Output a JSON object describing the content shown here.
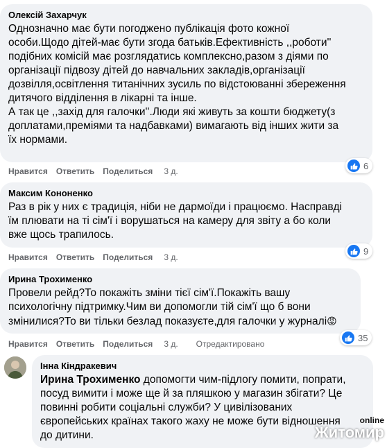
{
  "actions": {
    "like": "Нравится",
    "reply": "Ответить",
    "share": "Поделиться"
  },
  "comments": [
    {
      "author": "Олексій Захарчук",
      "text": "Однозначно має бути погоджено публікація фото кожної\nособи.Щодо дітей-має бути згода батьків.Ефективність ,,роботи''\nподібних комісій має розглядатись комплексно,разом з діями по\nорганізації підвозу дітей до навчальних закладів,організації\nдозвілля,освітлення титанічних зусиль по відстоюванні збереження\nдитячого відділення в лікарні та інше.\nА так це ,,захід для галочки''.Люди які живуть за кошти бюджету(з\nдоплатами,преміями та надбавками) вимагають від інших жити за\nїх нормами.",
      "time": "3 д.",
      "reactions": "6"
    },
    {
      "author": "Максим Кононенко",
      "text": "Раз в рік у них є традиція, ніби не дармоїди і працюємо. Насправді\nїм плювати на ті сім'ї і ворушаться на камеру для звіту а бо коли\nвже щось трапилось.",
      "time": "3 д.",
      "reactions": "9"
    },
    {
      "author": "Ирина Трохименко",
      "text": "Провели рейд?То покажіть зміни тієї сім'ї.Покажіть вашу\nпсихологічну підтримку.Чим ви допомогли тій сім'ї що б вони\nзмінилися?То ви тільки безлад показуєте,для галочки у журналі",
      "emoji": "😡",
      "time": "3 д.",
      "edited": "Отредактировано",
      "reactions": "35"
    },
    {
      "author": "Інна Кіндракевич",
      "mention": "Ирина Трохименко",
      "text": " допомогти чим-підлогу помити, попрати,\nпосуд вимити і може ще й за пляшкою у магазин збігати? Це\nповинні робити соціальні служби? У цивілізованих\nєвропейських країнах такого жаху не може бути відношення\nдо дитини."
    }
  ],
  "watermark": {
    "small": "online",
    "big": "Житомир"
  },
  "colors": {
    "bubble": "#f0f2f5",
    "meta": "#65676b",
    "like": "#1877f2"
  }
}
